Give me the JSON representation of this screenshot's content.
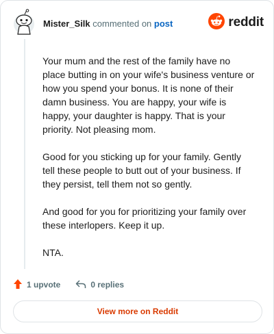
{
  "comment": {
    "author": "Mister_Silk",
    "action_text": "commented on",
    "post_link": "post",
    "paragraphs": [
      "Your mum and the rest of the family have no place butting in on your wife's business venture or how you spend your bonus. It is none of their damn business. You are happy, your wife is happy, your daughter is happy. That is your priority. Not pleasing mom.",
      "Good for you sticking up for your family. Gently tell these people to butt out of your business. If they persist, tell them not so gently.",
      "And good for you for prioritizing your family over these interlopers. Keep it up.",
      "NTA."
    ]
  },
  "brand": {
    "wordmark": "reddit",
    "color": "#ff4500"
  },
  "actions": {
    "upvotes": "1 upvote",
    "replies": "0 replies"
  },
  "footer": {
    "view_more": "View more on Reddit"
  },
  "colors": {
    "link": "#0a66c2",
    "accent": "#d93a00",
    "muted": "#576f76",
    "upvote": "#ff4500"
  },
  "icons": [
    "avatar-icon",
    "reddit-logo-icon",
    "upvote-arrow-icon",
    "reply-arrow-icon"
  ]
}
